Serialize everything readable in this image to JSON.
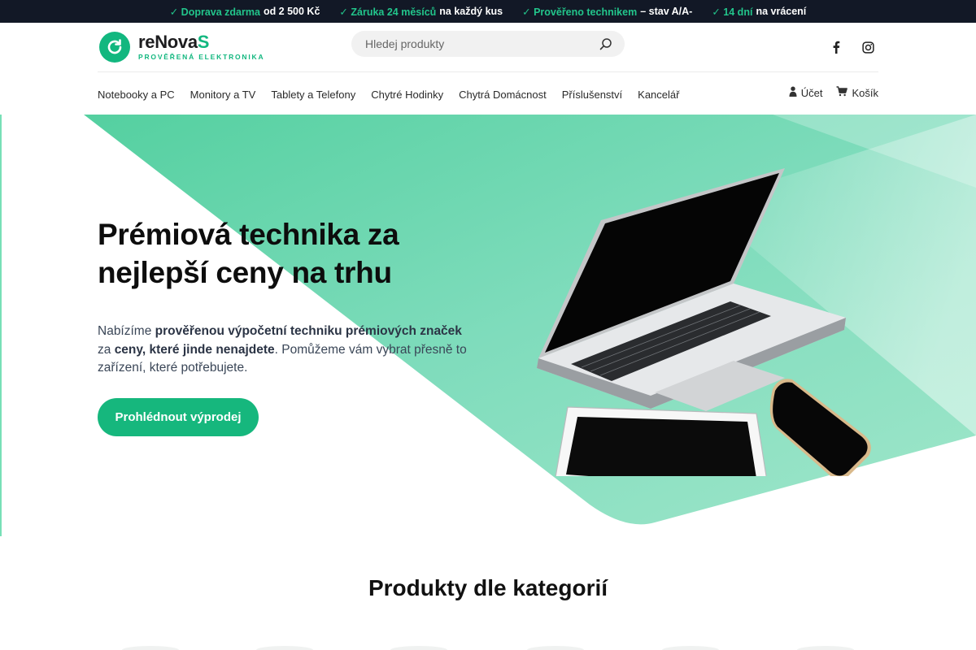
{
  "topbar": {
    "items": [
      {
        "highlight": "✓ Doprava zdarma",
        "text": "od 2 500 Kč"
      },
      {
        "highlight": "✓ Záruka 24 měsíců",
        "text": "na každý kus"
      },
      {
        "highlight": "✓ Prověřeno technikem",
        "text": "– stav A/A-"
      },
      {
        "highlight": "✓ 14 dní",
        "text": "na vrácení"
      }
    ]
  },
  "header": {
    "logo": {
      "name_part1": "reNova",
      "name_part2": "S",
      "tagline": "PROVĚŘENÁ ELEKTRONIKA",
      "icon": "refresh-icon"
    },
    "search": {
      "placeholder": "Hledej produkty",
      "value": "",
      "icon": "search-icon"
    },
    "social": [
      "facebook-icon",
      "instagram-icon"
    ]
  },
  "nav": {
    "items": [
      {
        "label": "Notebooky a PC"
      },
      {
        "label": "Monitory a TV"
      },
      {
        "label": "Tablety a Telefony"
      },
      {
        "label": "Chytré Hodinky"
      },
      {
        "label": "Chytrá Domácnost"
      },
      {
        "label": "Příslušenství"
      },
      {
        "label": "Kancelář"
      }
    ],
    "account_label": "Účet",
    "cart_label": "Košík"
  },
  "hero": {
    "title_line1": "Prémiová technika za",
    "title_line2": "nejlepší ceny na trhu",
    "text_1": "Nabízíme ",
    "text_2": "prověřenou výpočetní techniku prémiových značek",
    "text_3": " za ",
    "text_4": "ceny, které jinde nenajdete",
    "text_5": ". Pomůžeme vám vybrat přesně to zařízení, které potřebujete.",
    "cta_label": "Prohlédnout výprodej"
  },
  "categories": {
    "title": "Produkty dle kategorií"
  },
  "colors": {
    "accent": "#16b77d",
    "topbar_bg": "#121826",
    "hero_green": "#5fd4a6"
  }
}
